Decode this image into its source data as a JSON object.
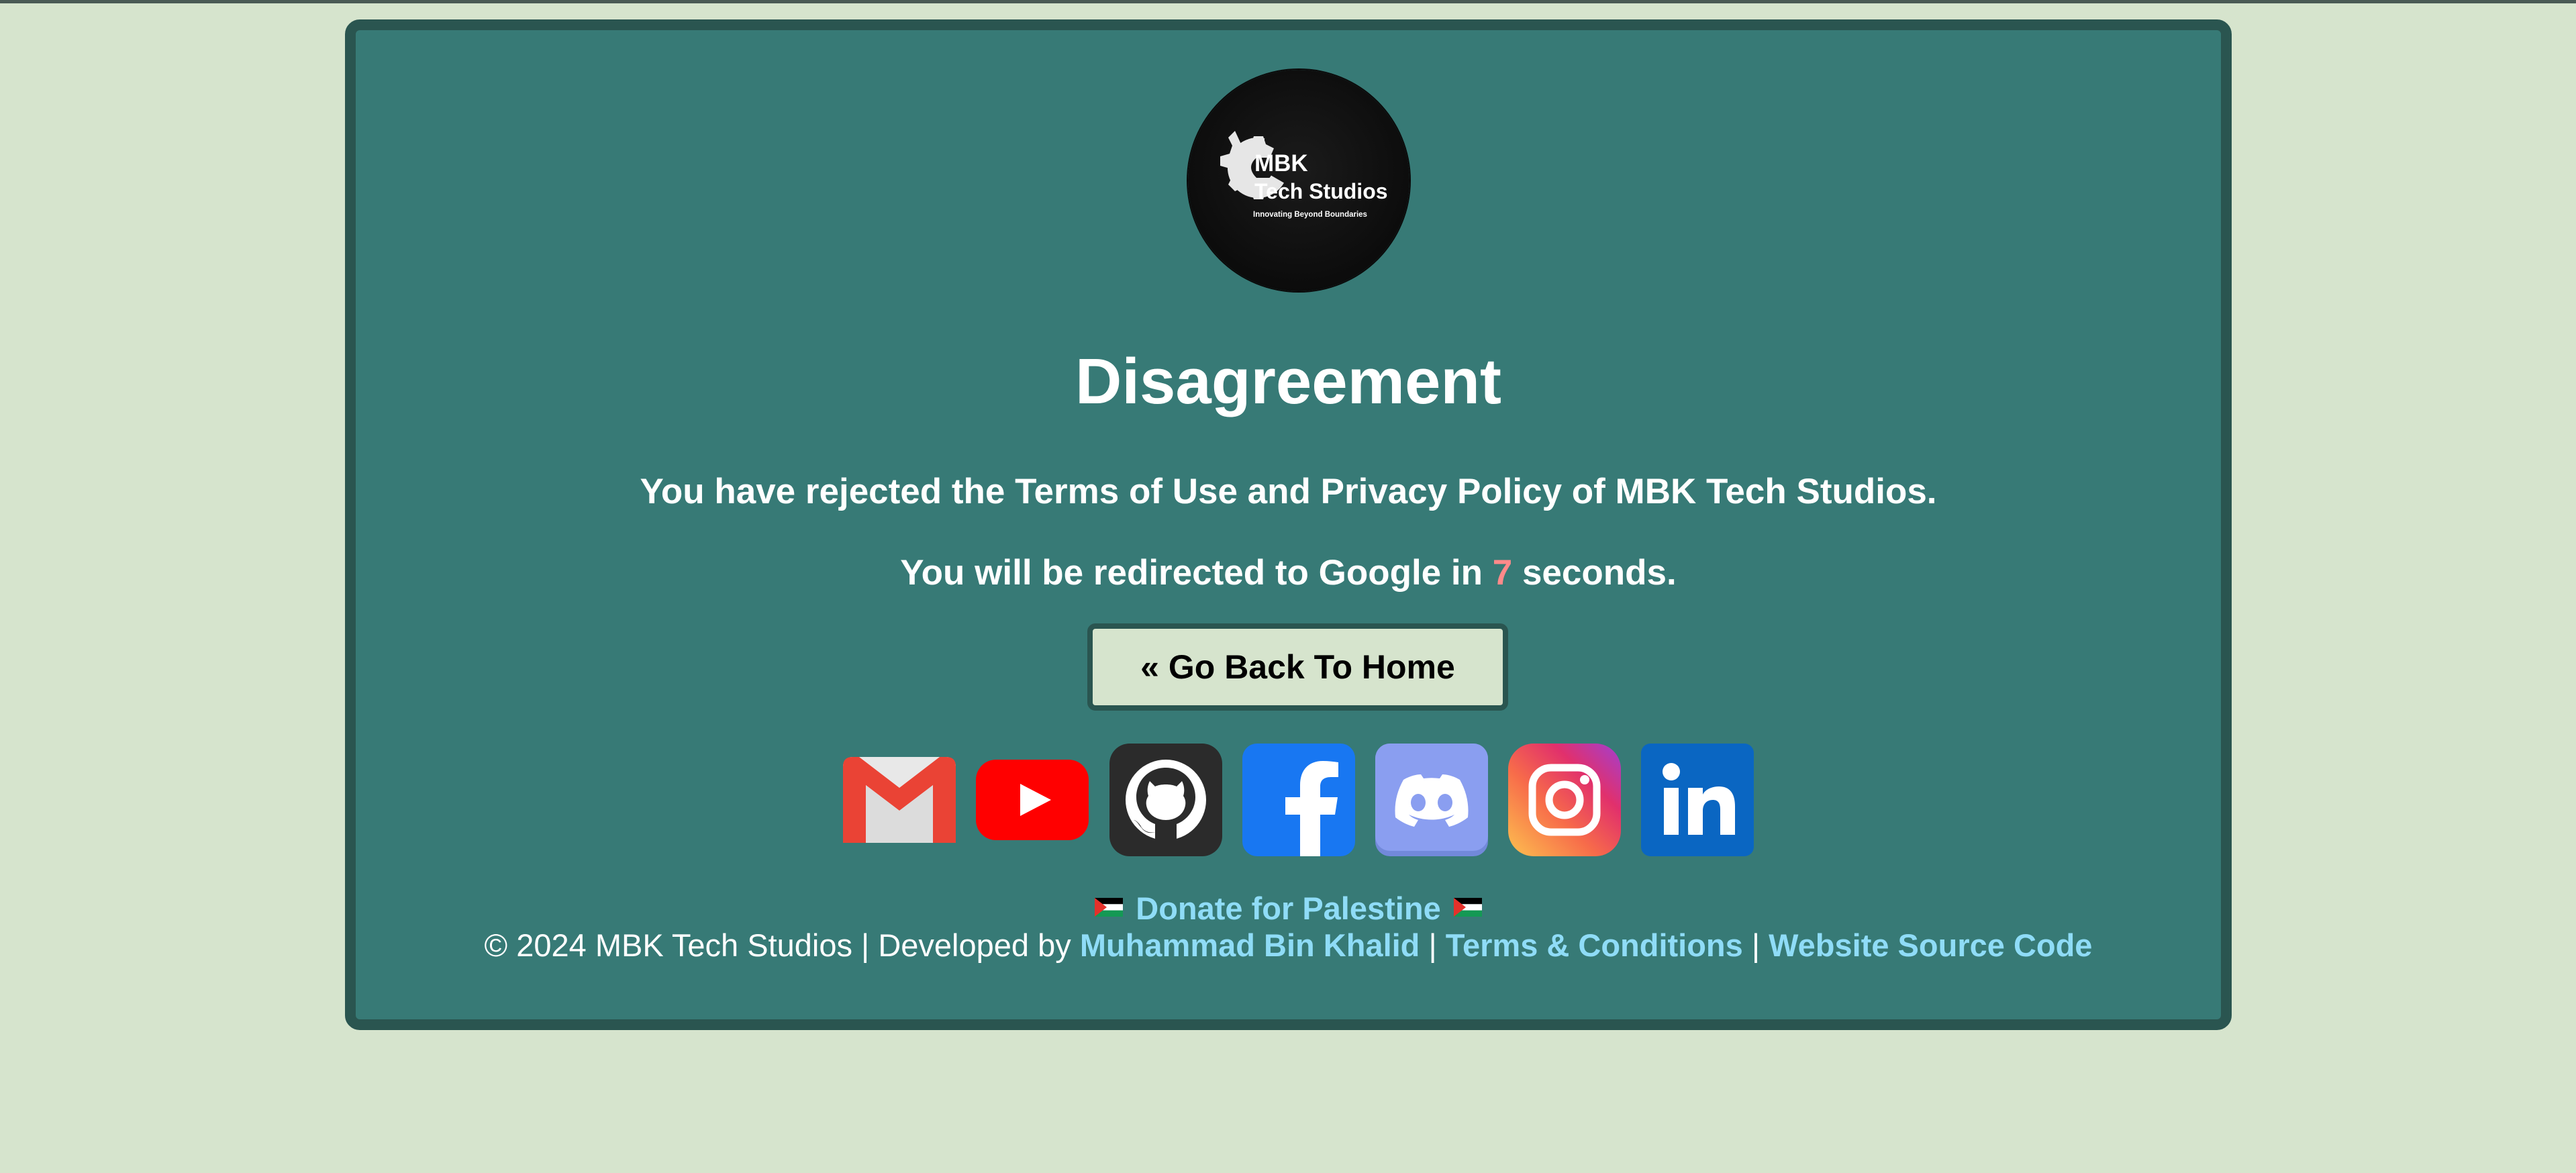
{
  "logo": {
    "line1": "MBK",
    "line2": "Tech Studios",
    "tagline": "Innovating Beyond Boundaries"
  },
  "heading": "Disagreement",
  "message": "You have rejected the Terms of Use and Privacy Policy of MBK Tech Studios.",
  "redirect": {
    "before": "You will be redirected to Google in",
    "count": "7",
    "after": "seconds."
  },
  "home_button": "« Go Back To Home",
  "social_icons": [
    "gmail-icon",
    "youtube-icon",
    "github-icon",
    "facebook-icon",
    "discord-icon",
    "instagram-icon",
    "linkedin-icon"
  ],
  "donate": "Donate for Palestine",
  "footer": {
    "copyright": "© 2024 MBK Tech Studios | Developed by",
    "developer": "Muhammad Bin Khalid",
    "sep1": "|",
    "terms": "Terms & Conditions",
    "sep2": "|",
    "source": "Website Source Code"
  },
  "colors": {
    "page_background": "#d6e4cd",
    "card_background": "#377a76",
    "card_border": "#2a5550",
    "link": "#8fdcf7",
    "countdown": "#ff8a8a"
  }
}
